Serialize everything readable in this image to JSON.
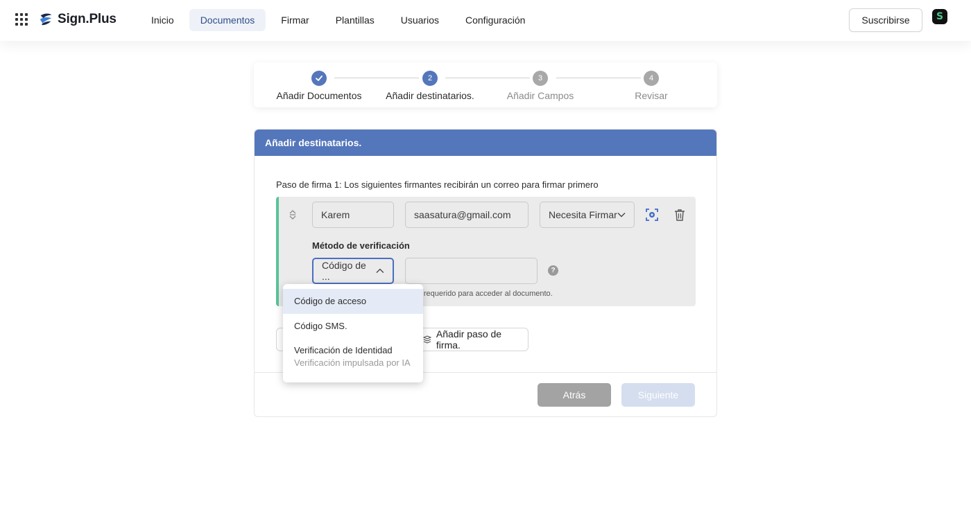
{
  "brand": {
    "name": "Sign.Plus",
    "accent": "#5476bb",
    "success": "#5ac49a"
  },
  "nav": {
    "items": [
      {
        "label": "Inicio",
        "active": false
      },
      {
        "label": "Documentos",
        "active": true
      },
      {
        "label": "Firmar",
        "active": false
      },
      {
        "label": "Plantillas",
        "active": false
      },
      {
        "label": "Usuarios",
        "active": false
      },
      {
        "label": "Configuración",
        "active": false
      }
    ],
    "subscribe_label": "Suscribirse",
    "avatar_letter": "S"
  },
  "stepper": {
    "steps": [
      {
        "number": "1",
        "label": "Añadir Documentos",
        "state": "done"
      },
      {
        "number": "2",
        "label": "Añadir destinatarios.",
        "state": "current"
      },
      {
        "number": "3",
        "label": "Añadir Campos",
        "state": "pending"
      },
      {
        "number": "4",
        "label": "Revisar",
        "state": "pending"
      }
    ]
  },
  "card": {
    "title": "Añadir destinatarios.",
    "step_title": "Paso de firma 1: Los siguientes firmantes recibirán un correo para firmar primero",
    "signer": {
      "name": "Karem",
      "email": "saasatura@gmail.com",
      "role": "Necesita Firmar",
      "verification_label": "Método de verificación",
      "verification_selected": "Código de ...",
      "verification_value": "",
      "hint": "rá requerido para acceder al documento."
    },
    "add_step_label": "Añadir paso de firma.",
    "back_label": "Atrás",
    "next_label": "Siguiente"
  },
  "dropdown": {
    "options": [
      {
        "label": "Código de acceso",
        "sub": "",
        "selected": true
      },
      {
        "label": "Código SMS.",
        "sub": "",
        "selected": false
      },
      {
        "label": "Verificación de Identidad",
        "sub": "Verificación impulsada por IA",
        "selected": false
      }
    ]
  }
}
